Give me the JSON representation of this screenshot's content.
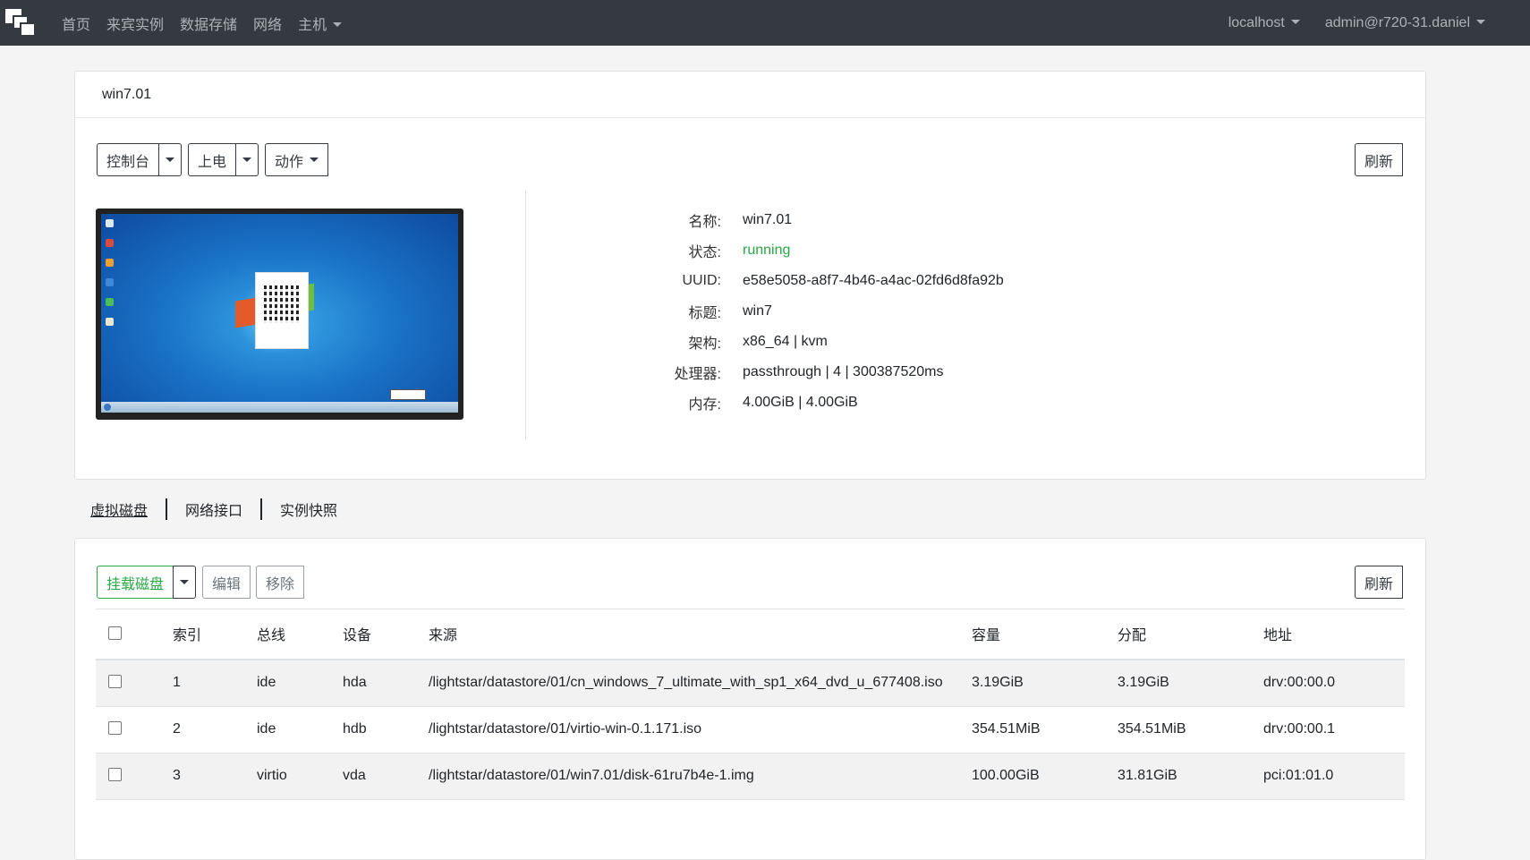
{
  "navbar": {
    "items": [
      "首页",
      "来宾实例",
      "数据存储",
      "网络",
      "主机"
    ],
    "host": "localhost",
    "user": "admin@r720-31.daniel"
  },
  "instance": {
    "header": "win7.01",
    "buttons": {
      "console": "控制台",
      "power": "上电",
      "action": "动作",
      "refresh": "刷新"
    },
    "details": [
      {
        "label": "名称:",
        "value": "win7.01"
      },
      {
        "label": "状态:",
        "value": "running"
      },
      {
        "label": "UUID:",
        "value": "e58e5058-a8f7-4b46-a4ac-02fd6d8fa92b"
      },
      {
        "label": "标题:",
        "value": "win7"
      },
      {
        "label": "架构:",
        "value": "x86_64 | kvm"
      },
      {
        "label": "处理器:",
        "value": "passthrough | 4 | 300387520ms"
      },
      {
        "label": "内存:",
        "value": "4.00GiB | 4.00GiB"
      }
    ],
    "status_color": "#28a745"
  },
  "tabs": [
    "虚拟磁盘",
    "网络接口",
    "实例快照"
  ],
  "disks": {
    "buttons": {
      "attach": "挂载磁盘",
      "edit": "编辑",
      "remove": "移除",
      "refresh": "刷新"
    },
    "columns": [
      "索引",
      "总线",
      "设备",
      "来源",
      "容量",
      "分配",
      "地址"
    ],
    "rows": [
      {
        "index": "1",
        "bus": "ide",
        "device": "hda",
        "source": "/lightstar/datastore/01/cn_windows_7_ultimate_with_sp1_x64_dvd_u_677408.iso",
        "capacity": "3.19GiB",
        "allocation": "3.19GiB",
        "address": "drv:00:00.0"
      },
      {
        "index": "2",
        "bus": "ide",
        "device": "hdb",
        "source": "/lightstar/datastore/01/virtio-win-0.1.171.iso",
        "capacity": "354.51MiB",
        "allocation": "354.51MiB",
        "address": "drv:00:00.1"
      },
      {
        "index": "3",
        "bus": "virtio",
        "device": "vda",
        "source": "/lightstar/datastore/01/win7.01/disk-61ru7b4e-1.img",
        "capacity": "100.00GiB",
        "allocation": "31.81GiB",
        "address": "pci:01:01.0"
      }
    ]
  }
}
